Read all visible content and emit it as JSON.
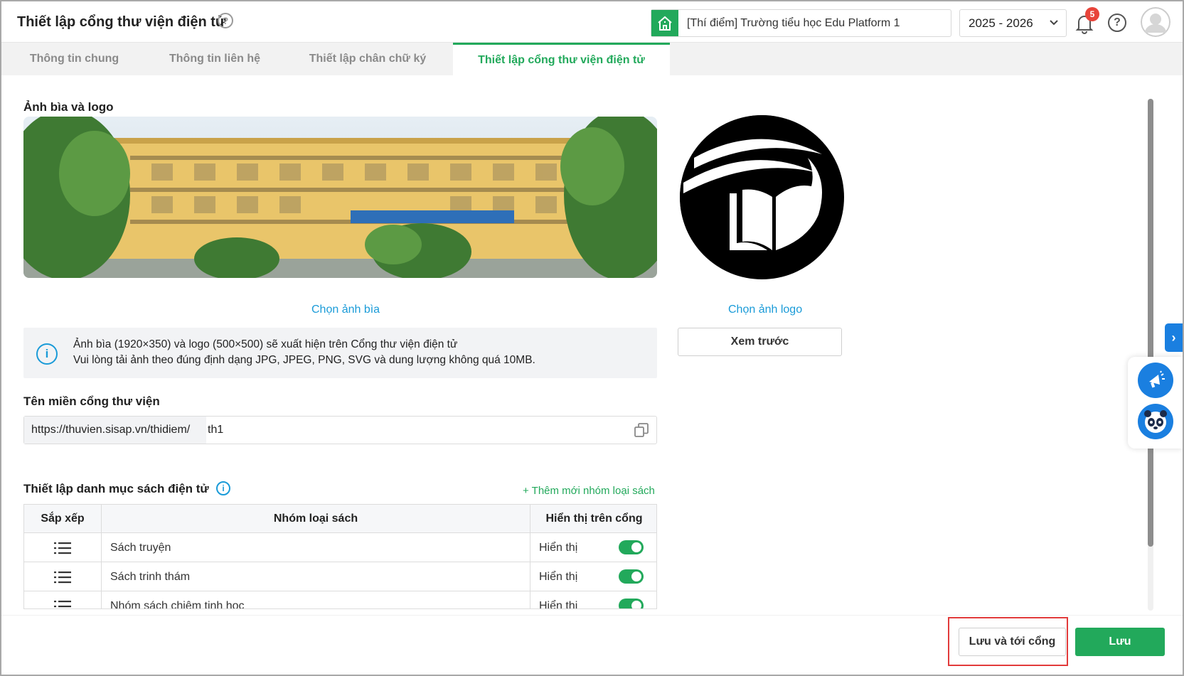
{
  "header": {
    "title": "Thiết lập cổng thư viện điện tử",
    "help_glyph": "?",
    "school_name": "[Thí điểm] Trường tiểu học Edu Platform 1",
    "school_year": "2025 - 2026",
    "notification_count": "5",
    "help_glyph_2": "?"
  },
  "tabs": [
    {
      "label": "Thông tin chung",
      "active": false
    },
    {
      "label": "Thông tin liên hệ",
      "active": false
    },
    {
      "label": "Thiết lập chân chữ ký",
      "active": false
    },
    {
      "label": "Thiết lập cổng thư viện điện tử",
      "active": true
    }
  ],
  "cover_logo": {
    "section_title": "Ảnh bìa và logo",
    "choose_cover": "Chọn ảnh bìa",
    "choose_logo": "Chọn ảnh logo",
    "preview_button": "Xem trước",
    "info_glyph": "i",
    "info_lines": [
      "Ảnh bìa (1920×350) và logo (500×500) sẽ xuất hiện trên Cổng thư viện điện tử",
      "Vui lòng tải ảnh theo đúng định dạng JPG, JPEG, PNG, SVG và dung lượng không quá 10MB."
    ]
  },
  "domain": {
    "section_title": "Tên miền cổng thư viện",
    "prefix": "https://thuvien.sisap.vn/thidiem/",
    "value": "th1"
  },
  "catalog": {
    "section_title": "Thiết lập danh mục sách điện tử",
    "info_glyph": "i",
    "add_link": "+ Thêm mới nhóm loại sách",
    "columns": [
      "Sắp xếp",
      "Nhóm loại sách",
      "Hiển thị trên cổng"
    ],
    "rows": [
      {
        "name": "Sách truyện",
        "status": "Hiển thị",
        "enabled": true
      },
      {
        "name": "Sách trinh thám",
        "status": "Hiển thị",
        "enabled": true
      },
      {
        "name": "Nhóm sách chiêm tinh học",
        "status": "Hiển thị",
        "enabled": true
      }
    ]
  },
  "side": {
    "expand_glyph": "›"
  },
  "footer": {
    "save_and_go": "Lưu và tới cổng",
    "save": "Lưu"
  },
  "colors": {
    "accent_green": "#22a95b",
    "link_blue": "#1a9bd8",
    "badge_red": "#e8443a",
    "highlight_red": "#e23b3b"
  }
}
